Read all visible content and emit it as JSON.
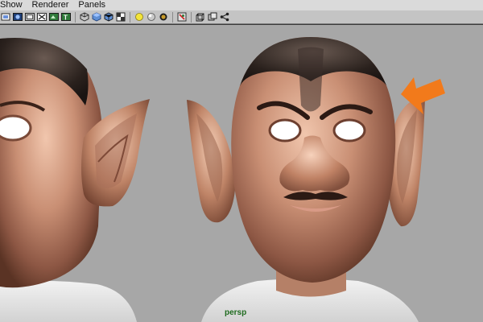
{
  "menubar": {
    "items": [
      {
        "label": "Show"
      },
      {
        "label": "Renderer"
      },
      {
        "label": "Panels"
      }
    ]
  },
  "toolbar": {
    "icons": [
      "frame-all-icon",
      "film-gate-icon",
      "resolution-gate-icon",
      "grid-icon",
      "image-plane-icon",
      "texture-placement-icon",
      "wireframe-icon",
      "smooth-shade-icon",
      "shaded-wireframe-icon",
      "textured-icon",
      "use-all-lights-icon",
      "shadows-icon",
      "hardware-texture-icon",
      "isolate-select-icon",
      "camera-icon",
      "multiple-cameras-icon",
      "share-icon"
    ]
  },
  "viewport": {
    "camera_label": "persp",
    "background_color": "#a7a7a7",
    "skin_color": "#b6826a",
    "arrow_color": "#f27a1b"
  }
}
